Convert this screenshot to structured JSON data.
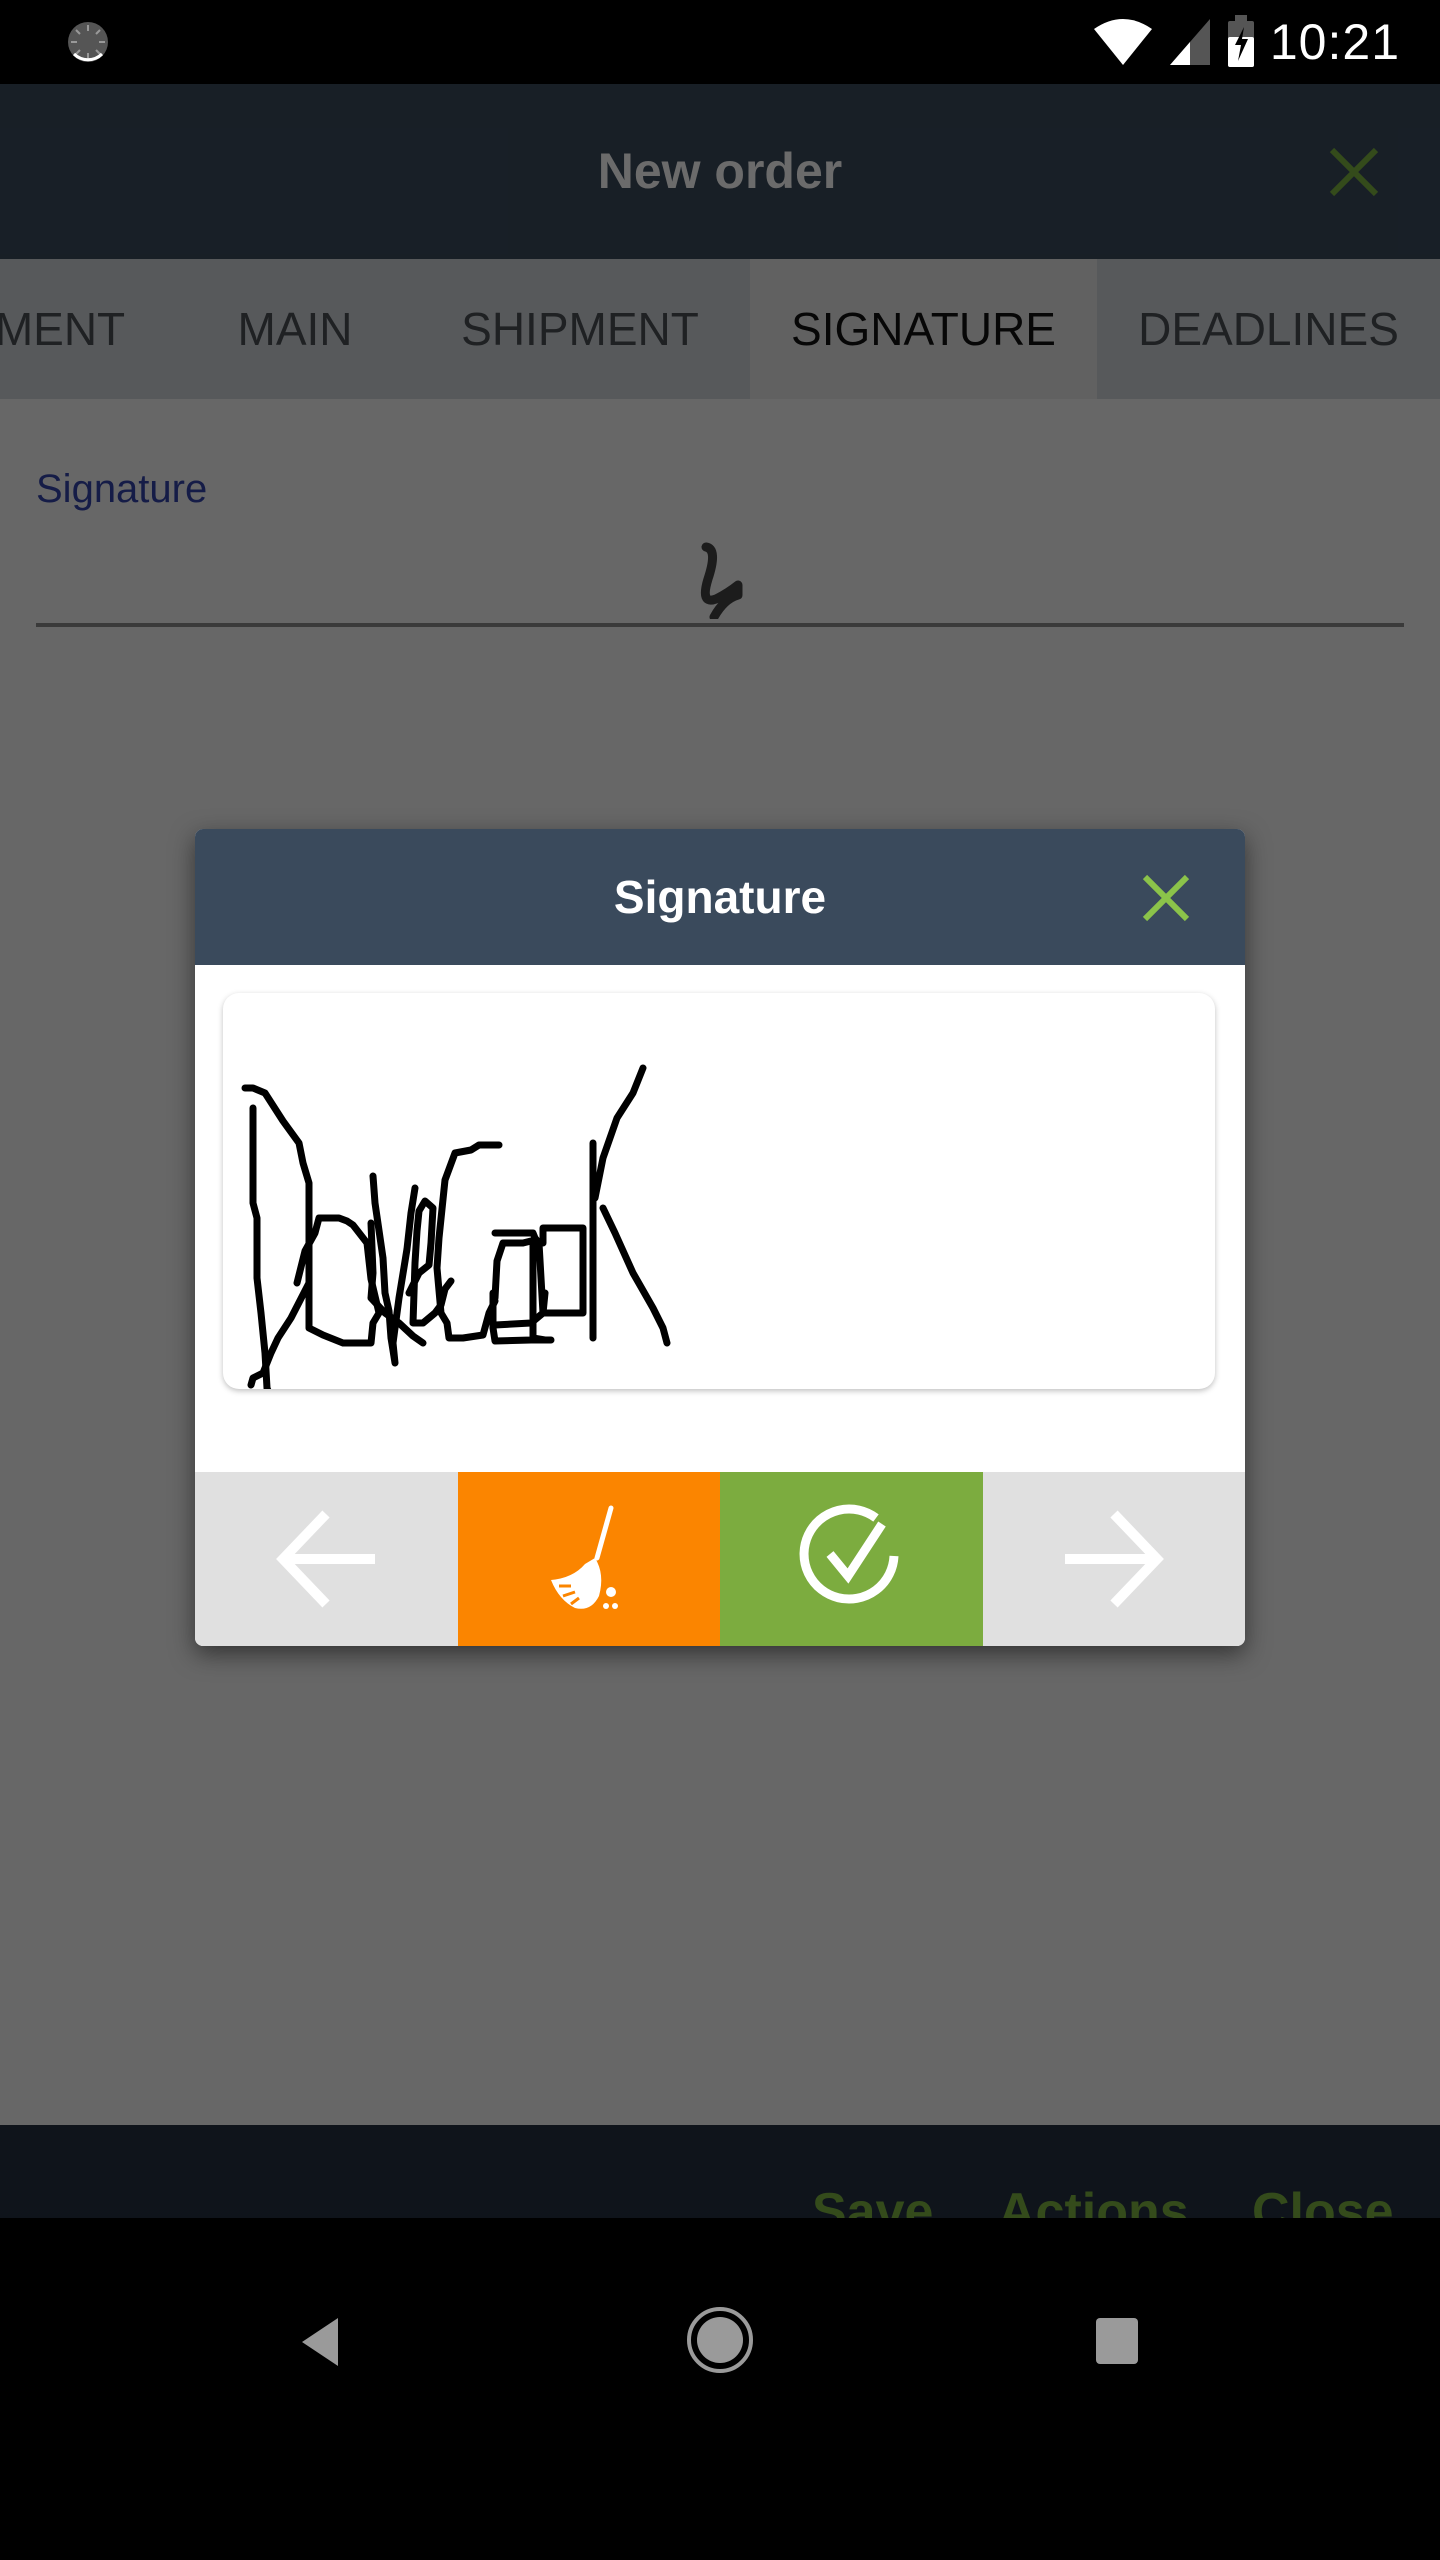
{
  "status_bar": {
    "time": "10:21",
    "icons": [
      "sync-icon",
      "wifi-icon",
      "cell-signal-icon",
      "battery-charging-icon"
    ]
  },
  "app_bar": {
    "title": "New order",
    "close_icon": "close-icon",
    "accent_color": "#7cb342"
  },
  "tabs": [
    {
      "label": "MENT",
      "active": false
    },
    {
      "label": "MAIN",
      "active": false
    },
    {
      "label": "SHIPMENT",
      "active": false
    },
    {
      "label": "SIGNATURE",
      "active": true
    },
    {
      "label": "DEADLINES",
      "active": false
    }
  ],
  "form": {
    "signature_label": "Signature",
    "signature_icon": "signature-icon"
  },
  "bottom_bar": {
    "save": "Save",
    "actions": "Actions",
    "close": "Close"
  },
  "dialog": {
    "title": "Signature",
    "close_icon": "close-icon",
    "signature_text": "DaveCook",
    "buttons": [
      {
        "name": "previous",
        "icon": "arrow-left-icon",
        "color": "#e0e0e0"
      },
      {
        "name": "clear",
        "icon": "broom-icon",
        "color": "#fb8500"
      },
      {
        "name": "confirm",
        "icon": "check-circle-icon",
        "color": "#7cac3f"
      },
      {
        "name": "next",
        "icon": "arrow-right-icon",
        "color": "#e0e0e0"
      }
    ]
  },
  "nav_bar": {
    "icons": [
      "back-icon",
      "home-icon",
      "recents-icon"
    ]
  }
}
